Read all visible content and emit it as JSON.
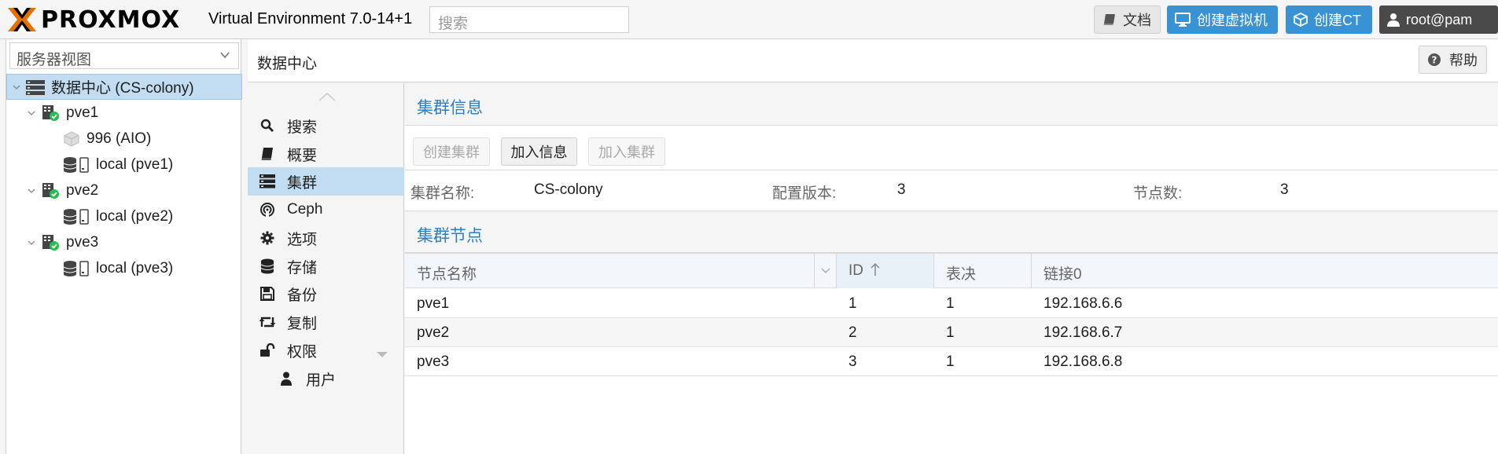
{
  "topbar": {
    "logo_text": "PROXMOX",
    "version": "Virtual Environment 7.0-14+1",
    "search_placeholder": "搜索",
    "docs_label": "文档",
    "create_vm_label": "创建虚拟机",
    "create_ct_label": "创建CT",
    "user_label": "root@pam"
  },
  "sidebar": {
    "view_select": "服务器视图",
    "tree": [
      {
        "label": "数据中心 (CS-colony)",
        "icon": "datacenter-icon"
      },
      {
        "label": "pve1",
        "icon": "node-online-icon"
      },
      {
        "label": "996 (AIO)",
        "icon": "vm-stopped-icon"
      },
      {
        "label": "local (pve1)",
        "icon": "storage-icon"
      },
      {
        "label": "pve2",
        "icon": "node-online-icon"
      },
      {
        "label": "local (pve2)",
        "icon": "storage-icon"
      },
      {
        "label": "pve3",
        "icon": "node-online-icon"
      },
      {
        "label": "local (pve3)",
        "icon": "storage-icon"
      }
    ]
  },
  "content_header": {
    "title": "数据中心",
    "help_label": "帮助"
  },
  "nav": {
    "items": [
      {
        "label": "搜索",
        "icon": "search-icon"
      },
      {
        "label": "概要",
        "icon": "book-icon"
      },
      {
        "label": "集群",
        "icon": "server-icon"
      },
      {
        "label": "Ceph",
        "icon": "ceph-icon"
      },
      {
        "label": "选项",
        "icon": "gear-icon"
      },
      {
        "label": "存储",
        "icon": "database-icon"
      },
      {
        "label": "备份",
        "icon": "floppy-icon"
      },
      {
        "label": "复制",
        "icon": "retweet-icon"
      },
      {
        "label": "权限",
        "icon": "unlock-icon"
      },
      {
        "label": "用户",
        "icon": "user-icon"
      }
    ]
  },
  "cluster_info": {
    "title": "集群信息",
    "create_cluster": "创建集群",
    "join_info": "加入信息",
    "join_cluster": "加入集群",
    "name_label": "集群名称:",
    "name_value": "CS-colony",
    "config_label": "配置版本:",
    "config_value": "3",
    "nodes_label": "节点数:",
    "nodes_value": "3"
  },
  "cluster_nodes": {
    "title": "集群节点",
    "columns": [
      "节点名称",
      "ID",
      "表决",
      "链接0"
    ],
    "rows": [
      {
        "name": "pve1",
        "id": "1",
        "votes": "1",
        "link0": "192.168.6.6"
      },
      {
        "name": "pve2",
        "id": "2",
        "votes": "1",
        "link0": "192.168.6.7"
      },
      {
        "name": "pve3",
        "id": "3",
        "votes": "1",
        "link0": "192.168.6.8"
      }
    ]
  },
  "colors": {
    "accent": "#3892d4",
    "selection": "#c2ddf2",
    "section_title": "#2d7fc0",
    "online": "#21bf4b",
    "logo_orange": "#e57000"
  }
}
